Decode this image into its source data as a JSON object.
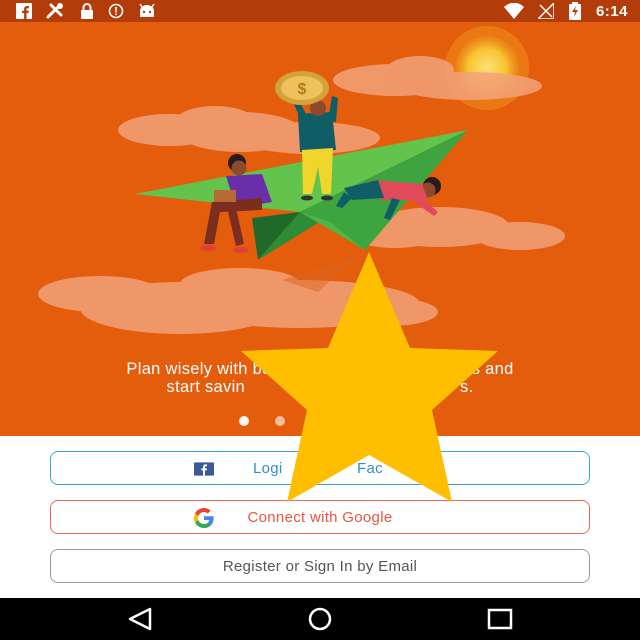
{
  "status_bar": {
    "time": "6:14",
    "left_icons": [
      "facebook-notification-icon",
      "tools-icon",
      "lock-icon",
      "alert-icon",
      "android-icon"
    ],
    "right_icons": [
      "wifi-icon",
      "no-signal-icon",
      "battery-charging-icon"
    ]
  },
  "hero": {
    "illustration": "people-on-paper-plane-illustration",
    "caption_line1": "Plan wisely with bu",
    "caption_line1_end": "extras and",
    "caption_line2": "start savin",
    "caption_line2_end": "s.",
    "pages": 2,
    "active_page": 0
  },
  "buttons": {
    "facebook_label_start": "Logi",
    "facebook_label_end": "Fac",
    "google_label": "Connect with Google",
    "email_label": "Register or Sign In by Email"
  },
  "overlay": {
    "shape": "star-icon",
    "color": "#ffbf00"
  },
  "nav": {
    "buttons": [
      "back-icon",
      "home-icon",
      "recents-icon"
    ]
  }
}
